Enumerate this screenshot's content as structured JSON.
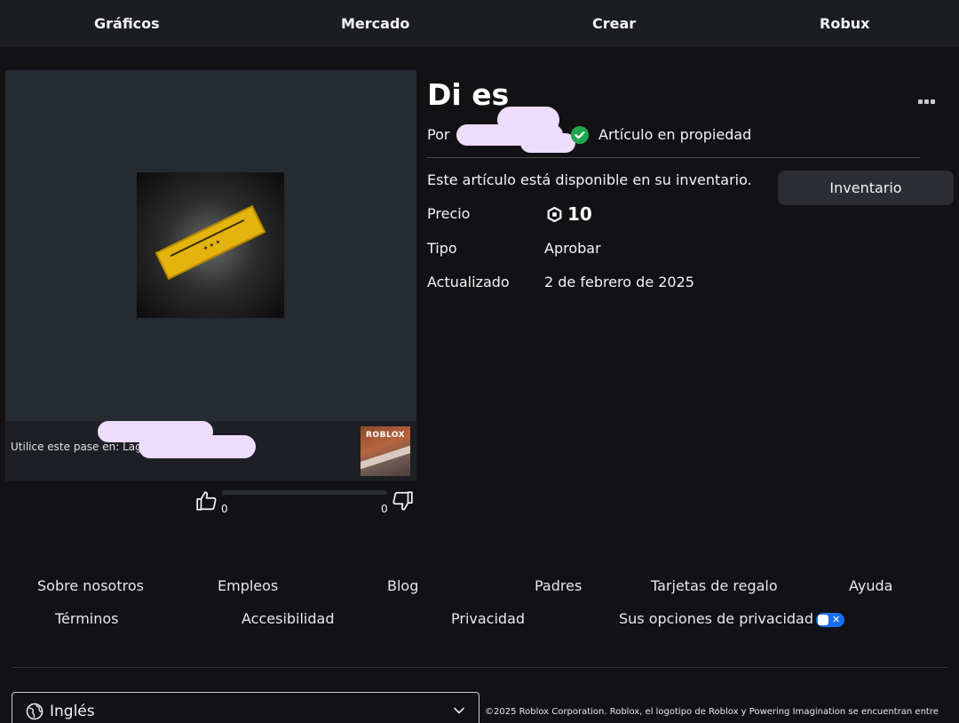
{
  "nav": {
    "items": [
      "Gráficos",
      "Mercado",
      "Crear",
      "Robux"
    ]
  },
  "item": {
    "title": "Di es",
    "by_label": "Por",
    "owned_label": "Artículo en propiedad",
    "available_text": "Este artículo está disponible en su inventario.",
    "inventory_button": "Inventario",
    "price_label": "Precio",
    "price_value": "10",
    "type_label": "Tipo",
    "type_value": "Aprobar",
    "updated_label": "Actualizado",
    "updated_value": "2 de febrero de 2025"
  },
  "thumbnail": {
    "use_text": "Utilice este pase en: Lag",
    "game_logo": "ROBLOX"
  },
  "votes": {
    "up": "0",
    "down": "0"
  },
  "footer": {
    "links": [
      "Sobre nosotros",
      "Empleos",
      "Blog",
      "Padres",
      "Tarjetas de regalo",
      "Ayuda",
      "Términos",
      "Accesibilidad",
      "Privacidad",
      "Sus opciones de privacidad"
    ],
    "language": "Inglés",
    "copyright": "©2025 Roblox Corporation. Roblox, el logotipo de Roblox y Powering Imagination se encuentran entre"
  },
  "colors": {
    "background": "#121215",
    "nav": "#1c1d21",
    "owned_check": "#1fa74d",
    "privacy_toggle": "#1a6ff0"
  },
  "icons": [
    "robux-icon",
    "check-circle-icon",
    "more-options-icon",
    "thumbs-up-icon",
    "thumbs-down-icon",
    "globe-icon",
    "chevron-down-icon"
  ]
}
